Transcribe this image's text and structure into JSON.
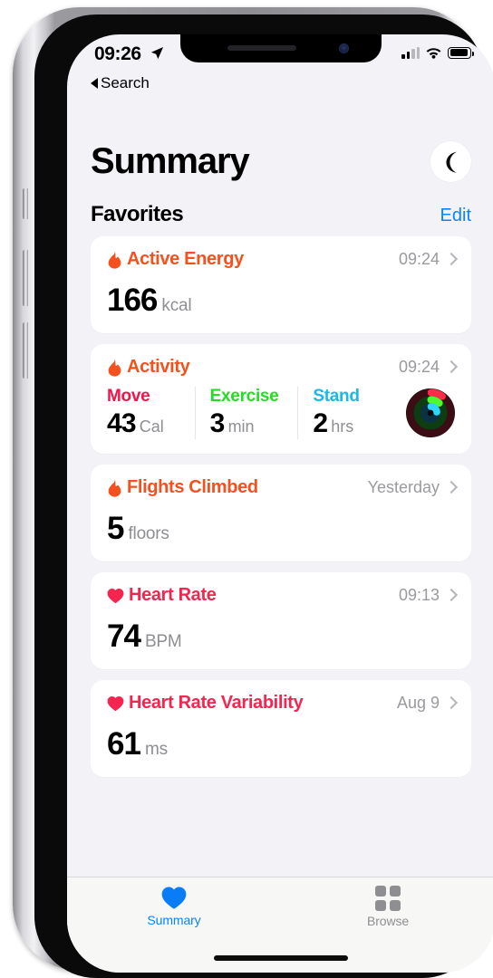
{
  "status_bar": {
    "time": "09:26",
    "location_icon": "location-arrow-icon",
    "cellular_icon": "cellular-bars-icon",
    "wifi_icon": "wifi-icon",
    "battery_icon": "battery-icon"
  },
  "back_link": {
    "label": "Search",
    "icon": "back-triangle-icon"
  },
  "header": {
    "title": "Summary",
    "avatar_icon": "crescent-moon-icon"
  },
  "section": {
    "title": "Favorites",
    "edit_label": "Edit",
    "edit_color": "#0a84ff"
  },
  "cards": [
    {
      "name": "active-energy",
      "icon": "flame-icon",
      "title": "Active Energy",
      "title_color": "#f4511e",
      "timestamp": "09:24",
      "value": "166",
      "unit": "kcal"
    },
    {
      "name": "activity",
      "icon": "flame-icon",
      "title": "Activity",
      "title_color": "#f4511e",
      "timestamp": "09:24",
      "metrics": [
        {
          "label": "Move",
          "color": "#f4124b",
          "value": "43",
          "unit": "Cal"
        },
        {
          "label": "Exercise",
          "color": "#22dd22",
          "value": "3",
          "unit": "min"
        },
        {
          "label": "Stand",
          "color": "#1ab8e8",
          "value": "2",
          "unit": "hrs"
        }
      ],
      "rings_icon": "activity-rings-icon"
    },
    {
      "name": "flights-climbed",
      "icon": "flame-icon",
      "title": "Flights Climbed",
      "title_color": "#f4511e",
      "timestamp": "Yesterday",
      "value": "5",
      "unit": "floors"
    },
    {
      "name": "heart-rate",
      "icon": "heart-icon",
      "title": "Heart Rate",
      "title_color": "#f5254f",
      "timestamp": "09:13",
      "value": "74",
      "unit": "BPM"
    },
    {
      "name": "heart-rate-variability",
      "icon": "heart-icon",
      "title": "Heart Rate Variability",
      "title_color": "#f5254f",
      "timestamp": "Aug 9",
      "value": "61",
      "unit": "ms"
    }
  ],
  "tab_bar": {
    "tabs": [
      {
        "label": "Summary",
        "icon": "heart-icon",
        "active": true,
        "color": "#0a84ff"
      },
      {
        "label": "Browse",
        "icon": "grid-icon",
        "active": false,
        "color": "#8e8e93"
      }
    ]
  }
}
